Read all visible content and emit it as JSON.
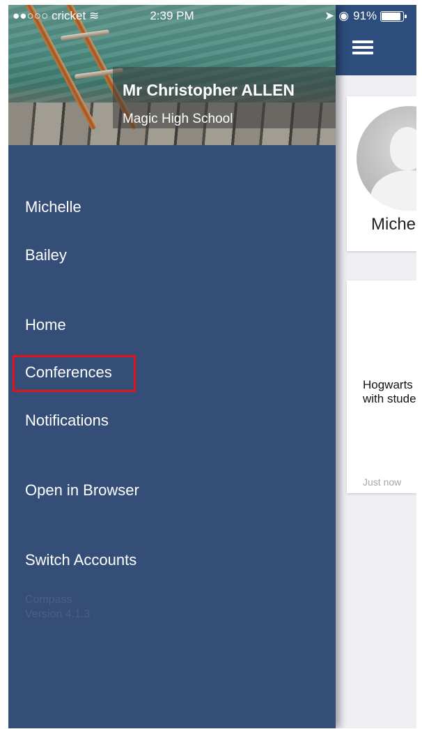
{
  "status_bar": {
    "carrier": "●●○○○ cricket",
    "time": "2:39 PM",
    "battery": "91%",
    "battery_level": 0.91
  },
  "drawer": {
    "user_name": "Mr Christopher ALLEN",
    "school": "Magic High School",
    "children": [
      {
        "label": "Michelle"
      },
      {
        "label": "Bailey"
      }
    ],
    "nav": [
      {
        "label": "Home"
      },
      {
        "label": "Conferences",
        "highlighted": true
      },
      {
        "label": "Notifications"
      }
    ],
    "open_in_browser": "Open in Browser",
    "switch_accounts": "Switch Accounts",
    "app_name": "Compass",
    "version": "Version 4.1.3"
  },
  "main": {
    "profile_name": "Michelle",
    "news_text": "Hogwarts students meet with students",
    "news_time": "Just now"
  },
  "colors": {
    "drawer_bg": "#344e78",
    "navbar_bg": "#2d4d7c",
    "highlight": "#e3131b"
  }
}
